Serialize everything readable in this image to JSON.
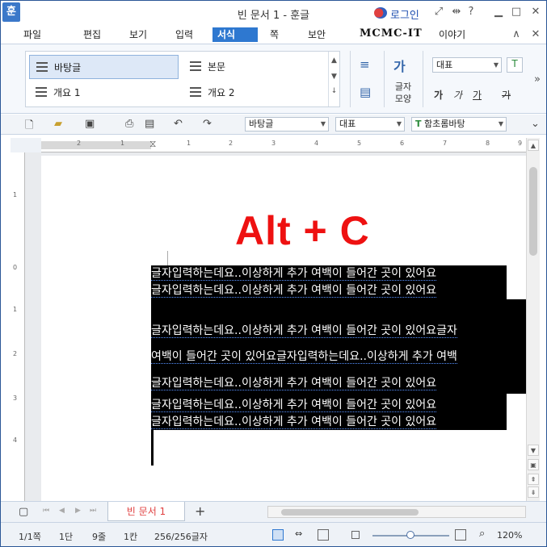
{
  "window": {
    "app_icon": "hwp-app-icon",
    "title": "빈 문서 1 - 훈글",
    "login_label": "로그인",
    "help_label": "?"
  },
  "menu": {
    "items": [
      "파일",
      "편집",
      "보기",
      "입력",
      "서식",
      "쪽",
      "보안",
      "이야기"
    ],
    "active": "서식",
    "brand_overlay": "MCMC-IT"
  },
  "ribbon": {
    "styles": [
      "바탕글",
      "본문",
      "개요 1",
      "개요 2"
    ],
    "selected_style": "바탕글",
    "char_shape_label_1": "글자",
    "char_shape_label_2": "모양",
    "font_name": "대표",
    "format_buttons": [
      "가",
      "가",
      "가",
      "가"
    ]
  },
  "toolbar": {
    "style_dropdown": "바탕글",
    "lang_dropdown": "대표",
    "font_dropdown": "함초롬바탕"
  },
  "ruler": {
    "h_ticks": [
      "2",
      "1",
      "1",
      "2",
      "3",
      "4",
      "5",
      "6",
      "7",
      "8",
      "9"
    ],
    "v_ticks": [
      "1",
      "0",
      "1",
      "2",
      "3",
      "4"
    ]
  },
  "document": {
    "overlay_text": "Alt + C",
    "lines": [
      "글자입력하는데요..이상하게 추가 여백이 들어간 곳이 있어요",
      "글자입력하는데요..이상하게 추가 여백이 들어간 곳이 있어요",
      "글자입력하는데요..이상하게 추가 여백이 들어간 곳이 있어요글자",
      "여백이 들어간 곳이 있어요글자입력하는데요..이상하게 추가 여백",
      "글자입력하는데요..이상하게 추가 여백이 들어간 곳이 있어요",
      "글자입력하는데요..이상하게 추가 여백이 들어간 곳이 있어요",
      "글자입력하는데요..이상하게 추가 여백이 들어간 곳이 있어요"
    ]
  },
  "tabs": {
    "doc_tab": "빈 문서 1",
    "add_tab": "+"
  },
  "status": {
    "page": "1/1쪽",
    "section": "1단",
    "line": "9줄",
    "column": "1칸",
    "chars": "256/256글자",
    "zoom": "120%"
  }
}
